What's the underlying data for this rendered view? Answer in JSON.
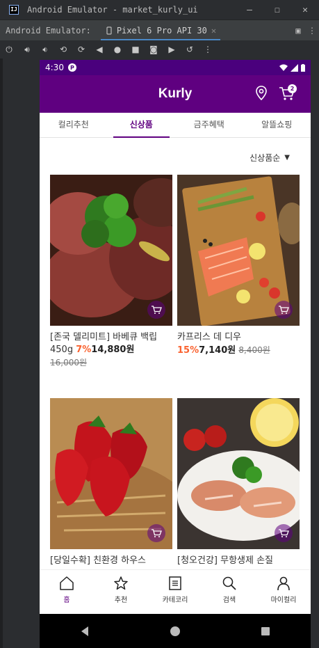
{
  "window": {
    "title": "Android Emulator - market_kurly_ui",
    "minimize": "—",
    "maximize": "☐",
    "close": "✕"
  },
  "emulator": {
    "tool_label": "Android Emulator:",
    "device_tab": "Pixel 6 Pro API 30",
    "tab_close": "✕"
  },
  "status": {
    "time": "4:30"
  },
  "app": {
    "title": "Kurly",
    "cart_count": "2"
  },
  "tabs": [
    {
      "label": "컬리추천"
    },
    {
      "label": "신상품"
    },
    {
      "label": "금주혜택"
    },
    {
      "label": "알뜰쇼핑"
    }
  ],
  "active_tab": 1,
  "sort": {
    "label": "신상품순"
  },
  "products": [
    {
      "name": "[존국 델리미트] 바베큐 백립 450g",
      "discount": "7%",
      "price": "14,880원",
      "original": "16,000원"
    },
    {
      "name": "카프리스 데 디우",
      "discount": "15%",
      "price": "7,140원",
      "original": "8,400원"
    },
    {
      "name": "[당일수확] 친환경 하우스",
      "discount": "",
      "price": "",
      "original": ""
    },
    {
      "name": "[청오건강] 무항생제 손질",
      "discount": "",
      "price": "",
      "original": ""
    }
  ],
  "bottom_nav": [
    {
      "label": "홈",
      "icon": "home-icon"
    },
    {
      "label": "추천",
      "icon": "star-icon"
    },
    {
      "label": "카테코리",
      "icon": "category-icon"
    },
    {
      "label": "검색",
      "icon": "search-icon"
    },
    {
      "label": "마이컬리",
      "icon": "person-icon"
    }
  ],
  "colors": {
    "brand": "#5f0080",
    "statusbar": "#4a007d",
    "discount": "#fa622f"
  }
}
